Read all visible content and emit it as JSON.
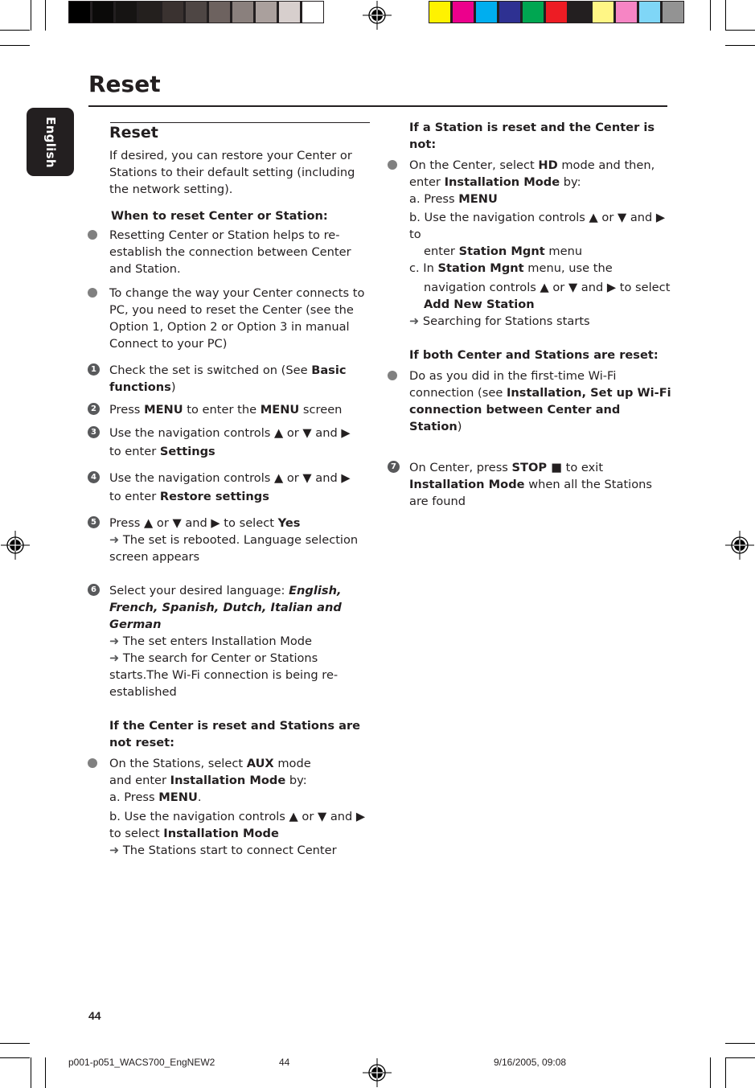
{
  "print_marks": {
    "grayscale_swatches": [
      "#000000",
      "#0b0a09",
      "#161413",
      "#24201e",
      "#3a3230",
      "#4e4644",
      "#6d625f",
      "#8a807d",
      "#aaa09d",
      "#d7cfcd",
      "#ffffff"
    ],
    "color_swatches": [
      "#fff200",
      "#ec008c",
      "#00aeef",
      "#2e3192",
      "#00a651",
      "#ed1c24",
      "#231f20",
      "#fff685",
      "#f685c4",
      "#7fd6f7",
      "#939393"
    ]
  },
  "language_tab": "English",
  "page_title": "Reset",
  "left_column": {
    "section_heading": "Reset",
    "intro": "If desired, you can restore your Center or Stations to their default setting (including the network setting).",
    "when_heading": "When to reset Center or Station:",
    "when_bullets": [
      "Resetting Center or Station helps to re-establish the connection between Center and Station.",
      "To change the way your Center connects to PC, you need to reset the Center (see the Option 1, Option 2 or Option 3 in manual Connect to your PC)"
    ],
    "steps": {
      "s1": {
        "num": "1",
        "pre": "Check the set is switched on (See ",
        "bold": "Basic functions",
        "post": ")"
      },
      "s2": {
        "num": "2",
        "pre": "Press ",
        "bold1": "MENU",
        "mid": " to enter the ",
        "bold2": "MENU",
        "post": " screen"
      },
      "s3": {
        "num": "3",
        "pre": "Use the navigation controls  ▲  or  ▼  and ▶",
        "line2": "to enter ",
        "bold": "Settings"
      },
      "s4": {
        "num": "4",
        "pre": "Use the navigation controls  ▲  or  ▼  and ▶",
        "line2": "to enter ",
        "bold": "Restore settings"
      },
      "s5": {
        "num": "5",
        "pre": "Press ▲  or  ▼  and ▶ to select ",
        "bold": "Yes",
        "arrow": "➜",
        "result": " The set is rebooted. Language selection screen appears"
      },
      "s6": {
        "num": "6",
        "pre": "Select your desired language: ",
        "bold": "English, French, Spanish, Dutch, Italian and German",
        "arrow": "➜",
        "result1": " The set enters Installation Mode",
        "result2": " The search for Center or Stations starts.The Wi-Fi connection is being re-established"
      }
    },
    "center_reset": {
      "heading": "If the Center is reset and Stations are not reset:",
      "p1_pre": "On the Stations, select ",
      "p1_bold": "AUX",
      "p1_post": " mode",
      "p2_pre": "and enter ",
      "p2_bold": "Installation Mode",
      "p2_post": " by:",
      "a_pre": "a. Press ",
      "a_bold": "MENU",
      "a_post": ".",
      "b_pre": "b. Use the navigation controls ▲  or  ▼  and ▶ to select ",
      "b_bold": "Installation Mode",
      "arrow": "➜",
      "result": " The Stations start to connect Center"
    }
  },
  "right_column": {
    "station_reset": {
      "heading": " If a Station is reset and the Center is not:",
      "p1_pre": "On the Center, select ",
      "p1_bold": "HD",
      "p1_post": " mode and then, enter ",
      "p1_bold2": "Installation Mode",
      "p1_post2": " by:",
      "a_pre": "a. Press ",
      "a_bold": "MENU",
      "b_pre": "b. Use the navigation controls ▲  or  ▼  and ▶ to",
      "b_line2_pre": "enter ",
      "b_bold": "Station Mgnt",
      "b_post": " menu",
      "c_pre": "c.  In ",
      "c_bold": "Station Mgnt",
      "c_post": " menu,  use the",
      "c_line2": "navigation controls ▲  or  ▼  and ▶ to select",
      "c_bold2": "Add New Station",
      "arrow": "➜",
      "result": " Searching for Stations starts"
    },
    "both_reset": {
      "heading": "If both Center and Stations are reset:",
      "p_pre": "Do as you did in the first-time Wi-Fi connection (see ",
      "p_bold": "Installation, Set up Wi-Fi connection between Center and Station",
      "p_post": ")"
    },
    "step7": {
      "num": "7",
      "pre": "On Center, press ",
      "bold1": "STOP ■",
      "mid": " to exit ",
      "bold2": "Installation Mode",
      "post": " when all the Stations are found"
    }
  },
  "page_number": "44",
  "footer": {
    "file": "p001-p051_WACS700_EngNEW2",
    "page": "44",
    "timestamp": "9/16/2005, 09:08"
  }
}
